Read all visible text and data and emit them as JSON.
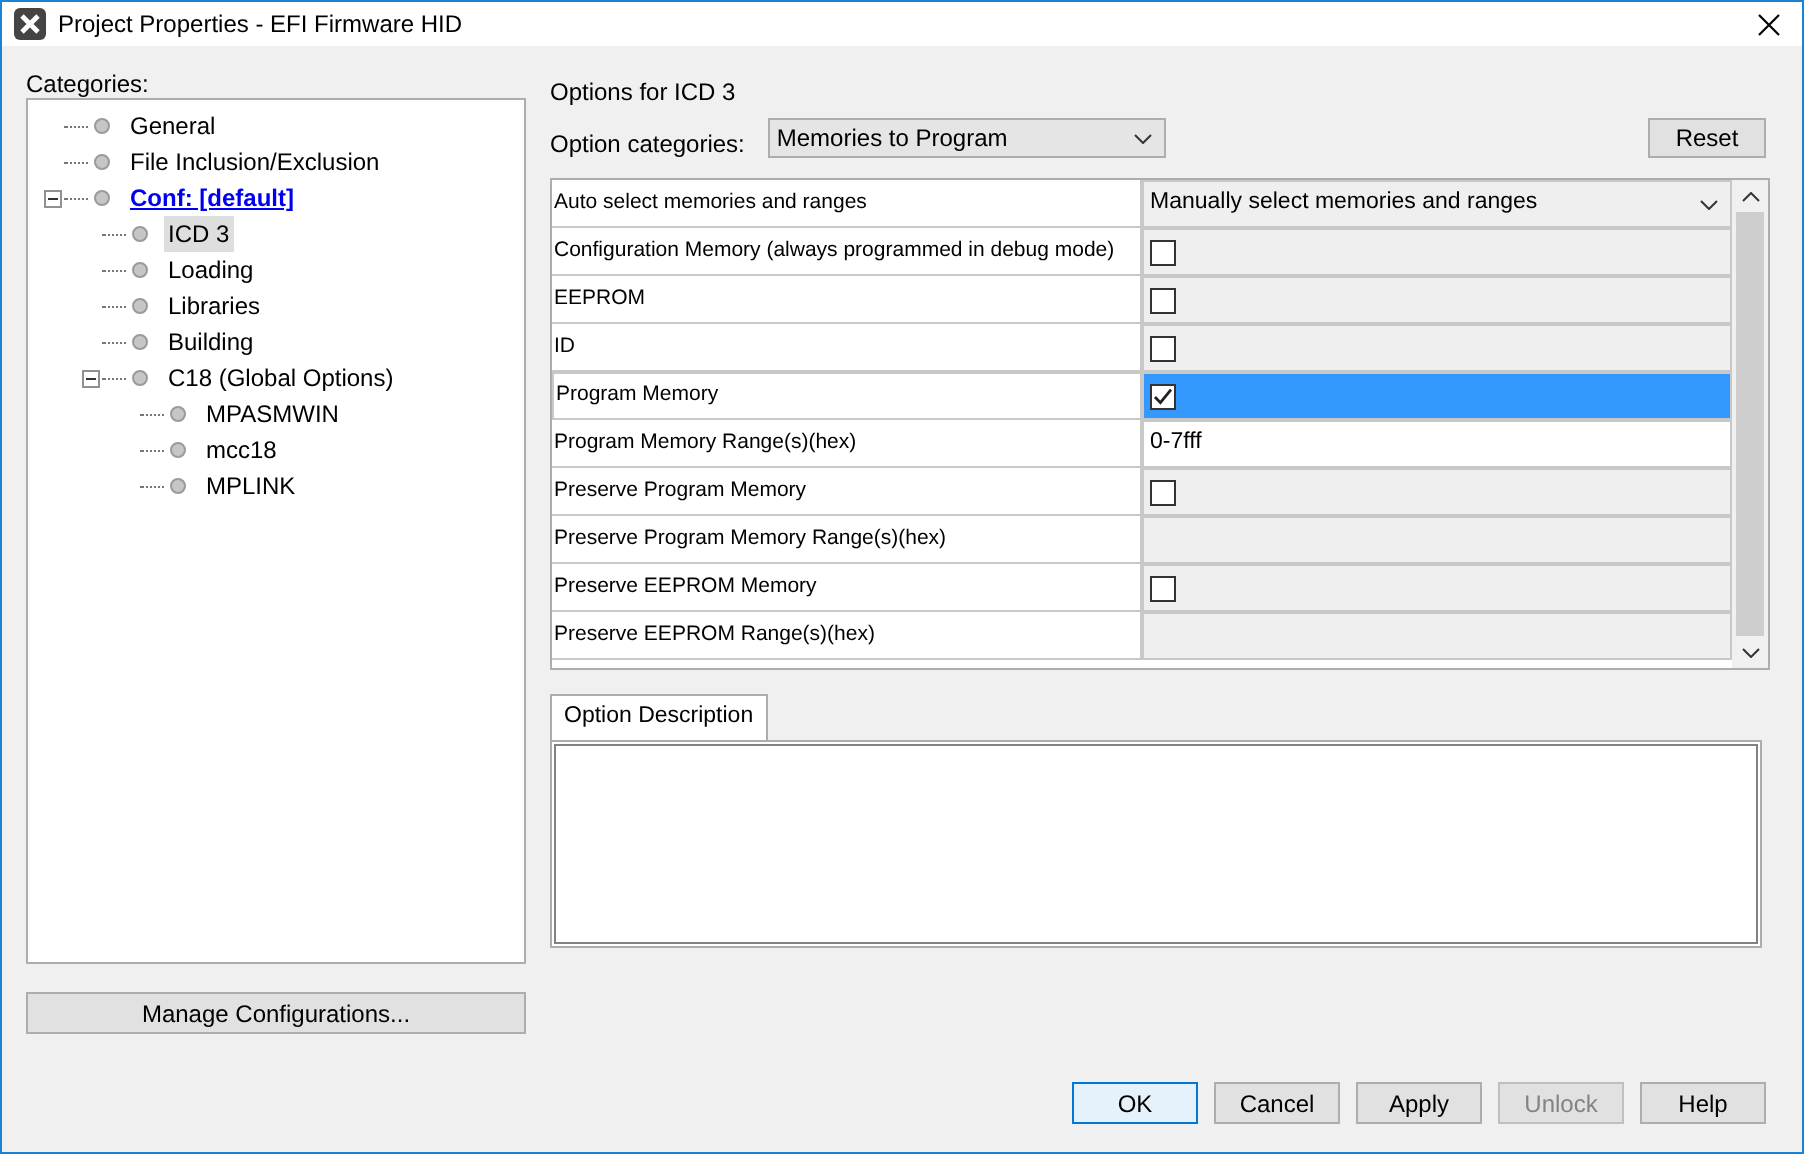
{
  "window": {
    "title": "Project Properties - EFI Firmware HID"
  },
  "categories": {
    "label": "Categories:",
    "tree": [
      {
        "label": "General",
        "selected": false,
        "link": false
      },
      {
        "label": "File Inclusion/Exclusion",
        "selected": false,
        "link": false
      },
      {
        "label": "Conf: [default]",
        "selected": false,
        "link": true,
        "expanded": true,
        "children": [
          {
            "label": "ICD 3",
            "selected": true,
            "link": false
          },
          {
            "label": "Loading",
            "selected": false,
            "link": false
          },
          {
            "label": "Libraries",
            "selected": false,
            "link": false
          },
          {
            "label": "Building",
            "selected": false,
            "link": false
          },
          {
            "label": "C18 (Global Options)",
            "selected": false,
            "link": false,
            "expanded": true,
            "children": [
              {
                "label": "MPASMWIN",
                "selected": false,
                "link": false
              },
              {
                "label": "mcc18",
                "selected": false,
                "link": false
              },
              {
                "label": "MPLINK",
                "selected": false,
                "link": false
              }
            ]
          }
        ]
      }
    ]
  },
  "manage_button": "Manage Configurations...",
  "options": {
    "title": "Options for ICD 3",
    "category_label": "Option categories:",
    "category_value": "Memories to Program",
    "reset": "Reset",
    "rows": [
      {
        "name": "Auto select memories and ranges",
        "kind": "dropdown",
        "value": "Manually select memories and ranges",
        "selected": false
      },
      {
        "name": "Configuration Memory (always programmed in debug mode)",
        "kind": "checkbox",
        "checked": false,
        "selected": false
      },
      {
        "name": "EEPROM",
        "kind": "checkbox",
        "checked": false,
        "selected": false
      },
      {
        "name": "ID",
        "kind": "checkbox",
        "checked": false,
        "selected": false
      },
      {
        "name": "Program Memory",
        "kind": "checkbox",
        "checked": true,
        "selected": true
      },
      {
        "name": "Program Memory Range(s)(hex)",
        "kind": "text",
        "value": "0-7fff",
        "selected": false
      },
      {
        "name": "Preserve Program Memory",
        "kind": "checkbox",
        "checked": false,
        "selected": false
      },
      {
        "name": "Preserve Program Memory Range(s)(hex)",
        "kind": "empty",
        "selected": false
      },
      {
        "name": "Preserve EEPROM Memory",
        "kind": "checkbox",
        "checked": false,
        "selected": false
      },
      {
        "name": "Preserve EEPROM Range(s)(hex)",
        "kind": "empty",
        "selected": false
      }
    ],
    "description_tab": "Option Description"
  },
  "buttons": [
    {
      "label": "OK",
      "default": true,
      "disabled": false
    },
    {
      "label": "Cancel",
      "default": false,
      "disabled": false
    },
    {
      "label": "Apply",
      "default": false,
      "disabled": false
    },
    {
      "label": "Unlock",
      "default": false,
      "disabled": true
    },
    {
      "label": "Help",
      "default": false,
      "disabled": false
    }
  ]
}
